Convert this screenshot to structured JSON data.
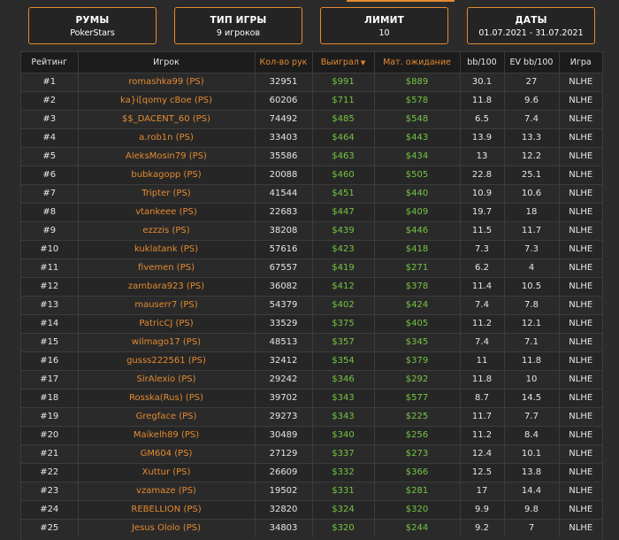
{
  "filters": [
    {
      "title": "РУМЫ",
      "value": "PokerStars"
    },
    {
      "title": "ТИП ИГРЫ",
      "value": "9 игроков"
    },
    {
      "title": "ЛИМИТ",
      "value": "10"
    },
    {
      "title": "ДАТЫ",
      "value": "01.07.2021 - 31.07.2021"
    }
  ],
  "table": {
    "headers": {
      "rank": "Рейтинг",
      "player": "Игрок",
      "hands": "Кол-во рук",
      "won": "Выиграл",
      "sort_arrow": "▼",
      "ev": "Мат. ожидание",
      "bb100": "bb/100",
      "evbb100": "EV bb/100",
      "game": "Игра"
    },
    "rows": [
      {
        "rank": "#1",
        "player": "romashka99 (PS)",
        "hands": "32951",
        "won": "$991",
        "ev": "$889",
        "bb": "30.1",
        "evbb": "27",
        "game": "NLHE"
      },
      {
        "rank": "#2",
        "player": "ka}i[qomy cBoe (PS)",
        "hands": "60206",
        "won": "$711",
        "ev": "$578",
        "bb": "11.8",
        "evbb": "9.6",
        "game": "NLHE"
      },
      {
        "rank": "#3",
        "player": "$$_DACENT_60 (PS)",
        "hands": "74492",
        "won": "$485",
        "ev": "$548",
        "bb": "6.5",
        "evbb": "7.4",
        "game": "NLHE"
      },
      {
        "rank": "#4",
        "player": "a.rob1n (PS)",
        "hands": "33403",
        "won": "$464",
        "ev": "$443",
        "bb": "13.9",
        "evbb": "13.3",
        "game": "NLHE"
      },
      {
        "rank": "#5",
        "player": "AleksMosin79 (PS)",
        "hands": "35586",
        "won": "$463",
        "ev": "$434",
        "bb": "13",
        "evbb": "12.2",
        "game": "NLHE"
      },
      {
        "rank": "#6",
        "player": "bubkagopp (PS)",
        "hands": "20088",
        "won": "$460",
        "ev": "$505",
        "bb": "22.8",
        "evbb": "25.1",
        "game": "NLHE"
      },
      {
        "rank": "#7",
        "player": "Tripter (PS)",
        "hands": "41544",
        "won": "$451",
        "ev": "$440",
        "bb": "10.9",
        "evbb": "10.6",
        "game": "NLHE"
      },
      {
        "rank": "#8",
        "player": "vtankeee (PS)",
        "hands": "22683",
        "won": "$447",
        "ev": "$409",
        "bb": "19.7",
        "evbb": "18",
        "game": "NLHE"
      },
      {
        "rank": "#9",
        "player": "ezzzis (PS)",
        "hands": "38208",
        "won": "$439",
        "ev": "$446",
        "bb": "11.5",
        "evbb": "11.7",
        "game": "NLHE"
      },
      {
        "rank": "#10",
        "player": "kuklatank (PS)",
        "hands": "57616",
        "won": "$423",
        "ev": "$418",
        "bb": "7.3",
        "evbb": "7.3",
        "game": "NLHE"
      },
      {
        "rank": "#11",
        "player": "fivemen (PS)",
        "hands": "67557",
        "won": "$419",
        "ev": "$271",
        "bb": "6.2",
        "evbb": "4",
        "game": "NLHE"
      },
      {
        "rank": "#12",
        "player": "zambara923 (PS)",
        "hands": "36082",
        "won": "$412",
        "ev": "$378",
        "bb": "11.4",
        "evbb": "10.5",
        "game": "NLHE"
      },
      {
        "rank": "#13",
        "player": "mauserr7 (PS)",
        "hands": "54379",
        "won": "$402",
        "ev": "$424",
        "bb": "7.4",
        "evbb": "7.8",
        "game": "NLHE"
      },
      {
        "rank": "#14",
        "player": "PatricCJ (PS)",
        "hands": "33529",
        "won": "$375",
        "ev": "$405",
        "bb": "11.2",
        "evbb": "12.1",
        "game": "NLHE"
      },
      {
        "rank": "#15",
        "player": "wilmago17 (PS)",
        "hands": "48513",
        "won": "$357",
        "ev": "$345",
        "bb": "7.4",
        "evbb": "7.1",
        "game": "NLHE"
      },
      {
        "rank": "#16",
        "player": "gusss222561 (PS)",
        "hands": "32412",
        "won": "$354",
        "ev": "$379",
        "bb": "11",
        "evbb": "11.8",
        "game": "NLHE"
      },
      {
        "rank": "#17",
        "player": "SirAlexio (PS)",
        "hands": "29242",
        "won": "$346",
        "ev": "$292",
        "bb": "11.8",
        "evbb": "10",
        "game": "NLHE"
      },
      {
        "rank": "#18",
        "player": "Rosska(Rus) (PS)",
        "hands": "39702",
        "won": "$343",
        "ev": "$577",
        "bb": "8.7",
        "evbb": "14.5",
        "game": "NLHE"
      },
      {
        "rank": "#19",
        "player": "Gregface (PS)",
        "hands": "29273",
        "won": "$343",
        "ev": "$225",
        "bb": "11.7",
        "evbb": "7.7",
        "game": "NLHE"
      },
      {
        "rank": "#20",
        "player": "Maikelh89 (PS)",
        "hands": "30489",
        "won": "$340",
        "ev": "$256",
        "bb": "11.2",
        "evbb": "8.4",
        "game": "NLHE"
      },
      {
        "rank": "#21",
        "player": "GM604 (PS)",
        "hands": "27129",
        "won": "$337",
        "ev": "$273",
        "bb": "12.4",
        "evbb": "10.1",
        "game": "NLHE"
      },
      {
        "rank": "#22",
        "player": "Xuttur (PS)",
        "hands": "26609",
        "won": "$332",
        "ev": "$366",
        "bb": "12.5",
        "evbb": "13.8",
        "game": "NLHE"
      },
      {
        "rank": "#23",
        "player": "vzamaze (PS)",
        "hands": "19502",
        "won": "$331",
        "ev": "$281",
        "bb": "17",
        "evbb": "14.4",
        "game": "NLHE"
      },
      {
        "rank": "#24",
        "player": "REBELLION (PS)",
        "hands": "32820",
        "won": "$324",
        "ev": "$320",
        "bb": "9.9",
        "evbb": "9.8",
        "game": "NLHE"
      },
      {
        "rank": "#25",
        "player": "Jesus Ololo (PS)",
        "hands": "34803",
        "won": "$320",
        "ev": "$244",
        "bb": "9.2",
        "evbb": "7",
        "game": "NLHE"
      }
    ]
  },
  "colors": {
    "accent": "#e48a30",
    "money": "#76c543",
    "background": "#2b2b2b"
  }
}
